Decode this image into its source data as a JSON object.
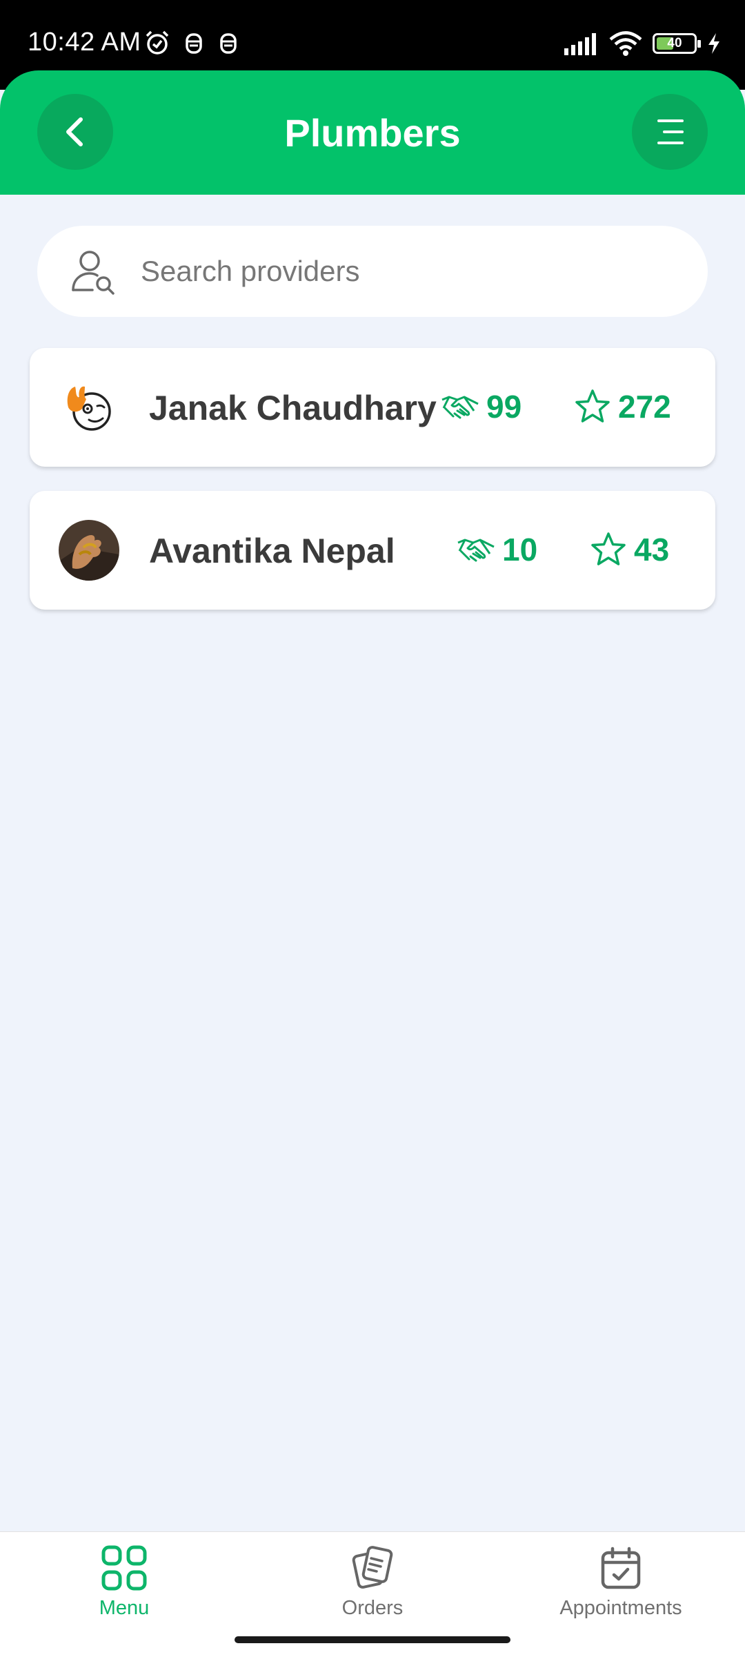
{
  "status_bar": {
    "time": "10:42 AM",
    "battery_level": "40",
    "icons": [
      "alarm-icon",
      "notification-icon",
      "notification-icon",
      "signal-icon",
      "wifi-icon",
      "battery-icon",
      "charging-icon"
    ]
  },
  "header": {
    "title": "Plumbers",
    "back_icon": "chevron-left-icon",
    "menu_icon": "menu-lines-icon",
    "background_color": "#03c26a"
  },
  "search": {
    "placeholder": "Search providers",
    "value": ""
  },
  "providers": [
    {
      "name": "Janak Chaudhary",
      "orders": "99",
      "rating": "272",
      "avatar": "hand-logo-avatar"
    },
    {
      "name": "Avantika Nepal",
      "orders": "10",
      "rating": "43",
      "avatar": "photo-avatar"
    }
  ],
  "bottom_nav": {
    "items": [
      {
        "label": "Menu",
        "icon": "grid-icon",
        "active": true
      },
      {
        "label": "Orders",
        "icon": "orders-icon",
        "active": false
      },
      {
        "label": "Appointments",
        "icon": "calendar-check-icon",
        "active": false
      }
    ]
  },
  "colors": {
    "accent": "#03c26a",
    "accent_dark": "#08a95d",
    "stat_green": "#0aa862",
    "background": "#eff3fb"
  }
}
